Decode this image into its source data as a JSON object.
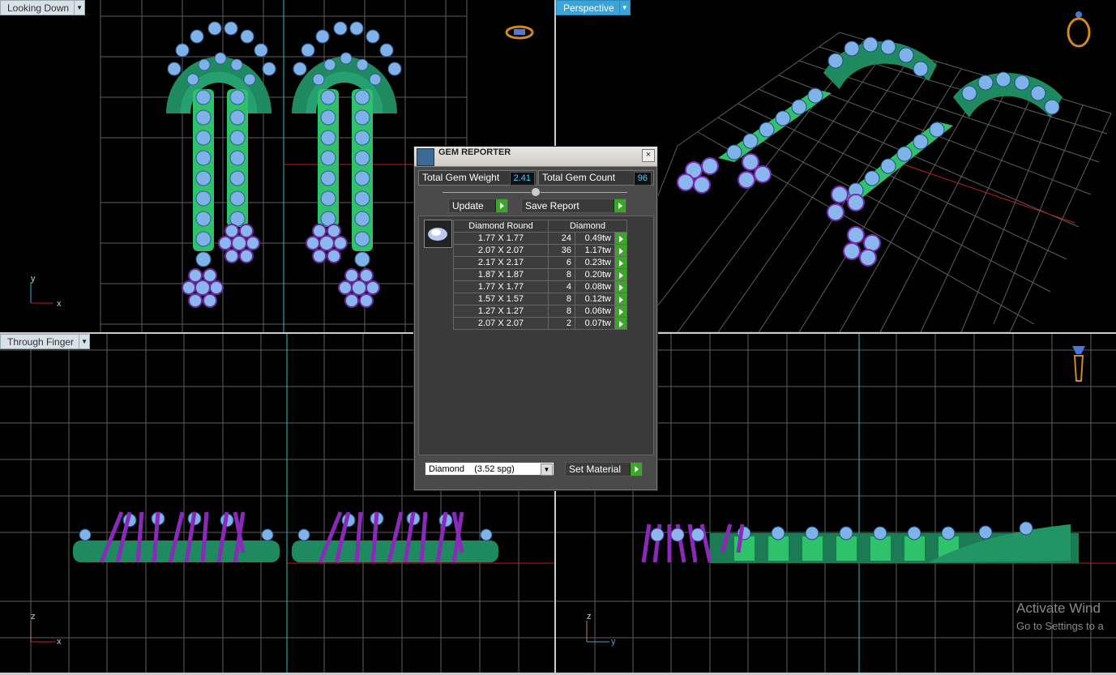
{
  "viewports": {
    "top_left": {
      "label": "Looking Down"
    },
    "top_right": {
      "label": "Perspective"
    },
    "bottom_left": {
      "label": "Through Finger"
    },
    "bottom_right": {
      "label": ""
    }
  },
  "axes": {
    "top_left": {
      "up": "y",
      "right": "x"
    },
    "bottom_left": {
      "up": "z",
      "right": "x"
    },
    "bottom_right": {
      "up": "z",
      "right": "y"
    }
  },
  "gem_reporter": {
    "title": "GEM REPORTER",
    "total_weight_label": "Total Gem Weight",
    "total_weight_value": "2.41",
    "total_count_label": "Total Gem Count",
    "total_count_value": "96",
    "update_label": "Update",
    "save_label": "Save Report",
    "columns": [
      "Diamond Round",
      "Diamond"
    ],
    "rows": [
      {
        "size": "1.77 X 1.77",
        "count": "24",
        "weight": "0.49tw"
      },
      {
        "size": "2.07 X 2.07",
        "count": "36",
        "weight": "1.17tw"
      },
      {
        "size": "2.17 X 2.17",
        "count": "6",
        "weight": "0.23tw"
      },
      {
        "size": "1.87 X 1.87",
        "count": "8",
        "weight": "0.20tw"
      },
      {
        "size": "1.77 X 1.77",
        "count": "4",
        "weight": "0.08tw"
      },
      {
        "size": "1.57 X 1.57",
        "count": "8",
        "weight": "0.12tw"
      },
      {
        "size": "1.27 X 1.27",
        "count": "8",
        "weight": "0.06tw"
      },
      {
        "size": "2.07 X 2.07",
        "count": "2",
        "weight": "0.07tw"
      }
    ],
    "material_select": "Diamond    (3.52 spg)",
    "set_material_label": "Set Material"
  },
  "watermark": {
    "line1": "Activate Wind",
    "line2": "Go to Settings to a"
  },
  "colors": {
    "grid": "#6a6a6a",
    "gem": "#7fb2e8",
    "metal_green": "#2aa070",
    "prong_purple": "#8a2ab8",
    "accent_blue": "#3aa3d8",
    "go_green": "#3da52a"
  }
}
